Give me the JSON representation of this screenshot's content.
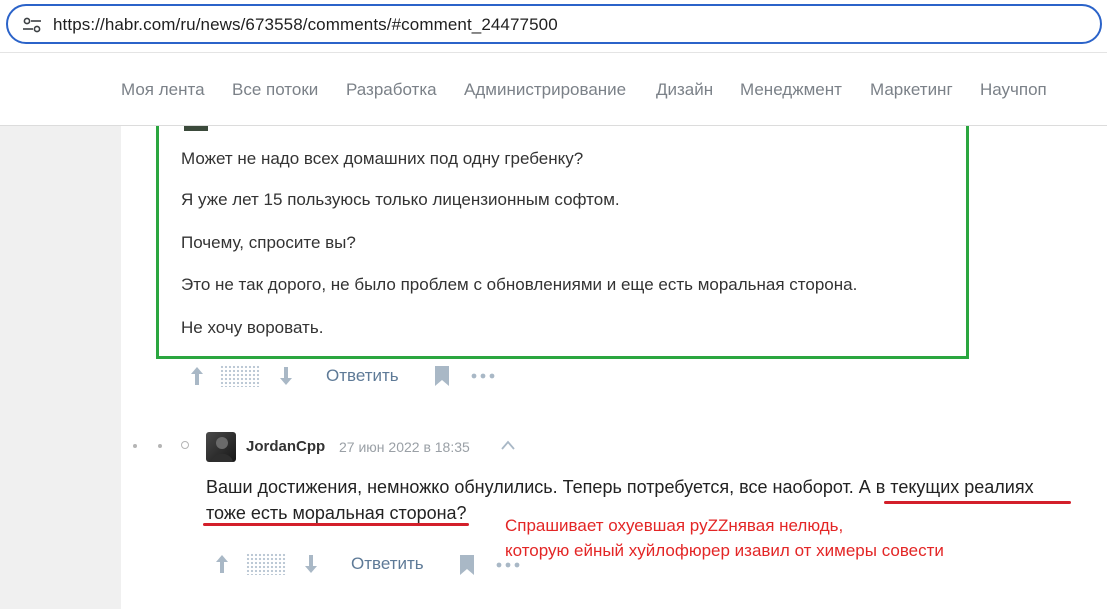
{
  "browser": {
    "url": "https://habr.com/ru/news/673558/comments/#comment_24477500"
  },
  "nav": {
    "items": [
      "Моя лента",
      "Все потоки",
      "Разработка",
      "Администрирование",
      "Дизайн",
      "Менеджмент",
      "Маркетинг",
      "Научпоп"
    ]
  },
  "comment1": {
    "paragraphs": [
      "Может не надо всех домашних под одну гребенку?",
      "Я уже лет 15 пользуюсь только лицензионным софтом.",
      "Почему, спросите вы?",
      "Это не так дорого, не было проблем с обновлениями и еще есть моральная сторона.",
      "Не хочу воровать."
    ],
    "reply_label": "Ответить"
  },
  "comment2": {
    "username": "JordanCpp",
    "date": "27 июн 2022 в 18:35",
    "line1": "Ваши достижения, немножко обнулились. Теперь потребуется, все наоборот. А в текущих реалиях",
    "line2": "тоже есть моральная сторона?",
    "reply_label": "Ответить"
  },
  "annotation": {
    "line1": "Спрашивает охуевшая руZZнявая нелюдь,",
    "line2": "которую ейный хуйлофюрер изавил от химеры совести"
  },
  "colors": {
    "highlight_box": "#2aa63f",
    "annotation": "#e32626",
    "underline": "#d31f2a",
    "url_border": "#2b63c9"
  }
}
